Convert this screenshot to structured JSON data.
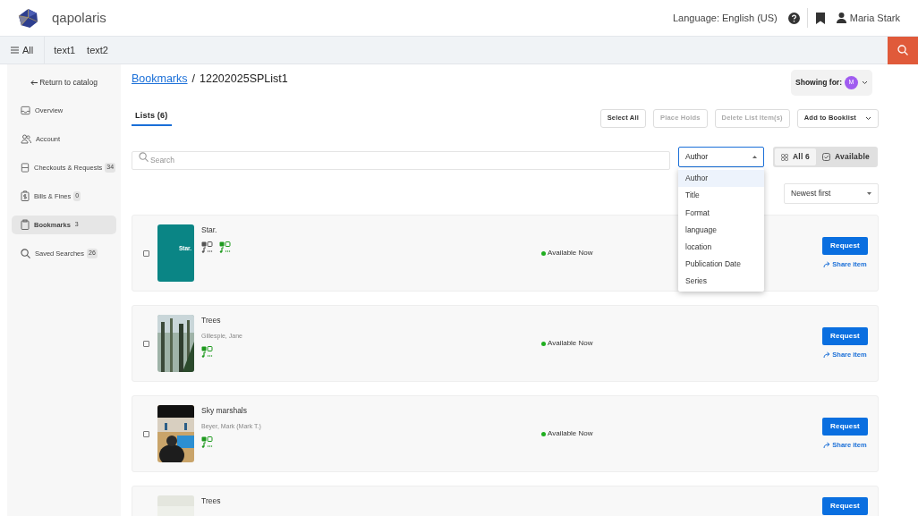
{
  "header": {
    "brand": "qapolaris",
    "language": "Language: English (US)",
    "user": "Maria Stark"
  },
  "nav": {
    "menu": "All",
    "links": [
      "text1",
      "text2"
    ]
  },
  "sidebar": {
    "back": "Return to catalog",
    "items": [
      {
        "label": "Overview",
        "selected": false
      },
      {
        "label": "Account",
        "selected": false
      },
      {
        "label": "Checkouts & Requests",
        "badge": "34",
        "selected": false
      },
      {
        "label": "Bills & Fines",
        "badge": "0",
        "selected": false
      },
      {
        "label": "Bookmarks",
        "badge": "3",
        "selected": true
      },
      {
        "label": "Saved Searches",
        "badge": "26",
        "selected": false
      }
    ]
  },
  "breadcrumb": {
    "parent": "Bookmarks",
    "separator": "/",
    "current": "12202025SPList1"
  },
  "showing_for": {
    "label": "Showing for:",
    "avatar": "M"
  },
  "tab": {
    "label": "Lists (6)",
    "selected": true
  },
  "actions": [
    {
      "label": "Select All",
      "disabled": false
    },
    {
      "label": "Place Holds",
      "disabled": true
    },
    {
      "label": "Delete List Item(s)",
      "disabled": true
    },
    {
      "label": "Add to Booklist",
      "disabled": false,
      "dropdown": true
    }
  ],
  "search": {
    "placeholder": "Search"
  },
  "field_select": {
    "value": "Author",
    "expanded": true,
    "options": [
      {
        "label": "Author",
        "selected": true
      },
      {
        "label": "Title",
        "selected": false
      },
      {
        "label": "Format",
        "selected": false
      },
      {
        "label": "language",
        "selected": false
      },
      {
        "label": "location",
        "selected": false
      },
      {
        "label": "Publication Date",
        "selected": false
      },
      {
        "label": "Series",
        "selected": false
      }
    ]
  },
  "filter": [
    {
      "label": "All 6",
      "selected": true
    },
    {
      "label": "Available",
      "selected": false
    }
  ],
  "sort": {
    "value": "Newest first"
  },
  "items": [
    {
      "title": "Star.",
      "checked": false,
      "cover": {
        "kind": "text",
        "text": "Star."
      },
      "formats": [
        {
          "color": "#555555"
        },
        {
          "color": "#1e9a1e"
        }
      ],
      "status": "Available Now",
      "color": "#1fae1f",
      "button": "Request",
      "share": "Share item"
    },
    {
      "title": "Trees",
      "checked": false,
      "author": "Gillespie, Jane",
      "cover": {
        "kind": "picture"
      },
      "formats": [
        {
          "color": "#1e9a1e"
        }
      ],
      "status": "Available Now",
      "color": "#1fae1f",
      "button": "Request",
      "share": "Share item"
    },
    {
      "title": "Sky marshals",
      "checked": false,
      "author": "Beyer, Mark (Mark T.)",
      "cover": {
        "kind": "picture"
      },
      "formats": [
        {
          "color": "#1e9a1e"
        }
      ],
      "status": "Available Now",
      "color": "#1fae1f",
      "button": "Request",
      "share": "Share item"
    },
    {
      "title": "Trees",
      "cover": {
        "kind": "picture"
      },
      "button": "Request"
    }
  ]
}
